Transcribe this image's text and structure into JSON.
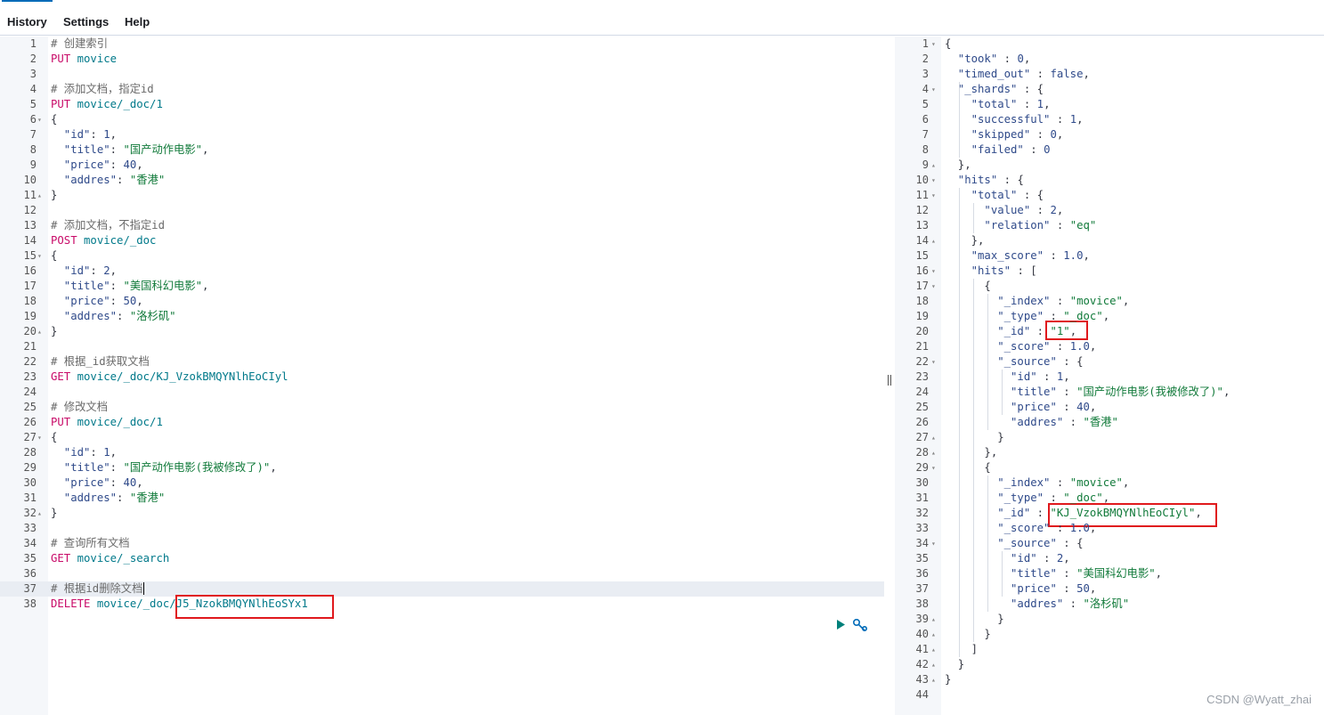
{
  "menu": {
    "history": "History",
    "settings": "Settings",
    "help": "Help"
  },
  "watermark": "CSDN @Wyatt_zhai",
  "colors": {
    "accent": "#006bb8",
    "highlight_box": "#e0191d",
    "method": "#c80a68",
    "url": "#00798a",
    "string": "#117a3a"
  },
  "icons": {
    "run": "play-icon",
    "settings": "wrench-icon"
  },
  "left": {
    "lines": [
      [
        {
          "t": "# 创建索引",
          "c": "comment"
        }
      ],
      [
        {
          "t": "PUT",
          "c": "method"
        },
        {
          "t": " movice",
          "c": "url"
        }
      ],
      [],
      [
        {
          "t": "# 添加文档，指定id",
          "c": "comment"
        }
      ],
      [
        {
          "t": "PUT",
          "c": "method"
        },
        {
          "t": " movice/_doc/1",
          "c": "url"
        }
      ],
      [
        {
          "t": "{",
          "c": "punc"
        }
      ],
      [
        {
          "t": "  \"id\"",
          "c": "key"
        },
        {
          "t": ": ",
          "c": "punc"
        },
        {
          "t": "1",
          "c": "num"
        },
        {
          "t": ",",
          "c": "punc"
        }
      ],
      [
        {
          "t": "  \"title\"",
          "c": "key"
        },
        {
          "t": ": ",
          "c": "punc"
        },
        {
          "t": "\"国产动作电影\"",
          "c": "str"
        },
        {
          "t": ",",
          "c": "punc"
        }
      ],
      [
        {
          "t": "  \"price\"",
          "c": "key"
        },
        {
          "t": ": ",
          "c": "punc"
        },
        {
          "t": "40",
          "c": "num"
        },
        {
          "t": ",",
          "c": "punc"
        }
      ],
      [
        {
          "t": "  \"addres\"",
          "c": "key"
        },
        {
          "t": ": ",
          "c": "punc"
        },
        {
          "t": "\"香港\"",
          "c": "str"
        }
      ],
      [
        {
          "t": "}",
          "c": "punc"
        }
      ],
      [],
      [
        {
          "t": "# 添加文档，不指定id",
          "c": "comment"
        }
      ],
      [
        {
          "t": "POST",
          "c": "method"
        },
        {
          "t": " movice/_doc",
          "c": "url"
        }
      ],
      [
        {
          "t": "{",
          "c": "punc"
        }
      ],
      [
        {
          "t": "  \"id\"",
          "c": "key"
        },
        {
          "t": ": ",
          "c": "punc"
        },
        {
          "t": "2",
          "c": "num"
        },
        {
          "t": ",",
          "c": "punc"
        }
      ],
      [
        {
          "t": "  \"title\"",
          "c": "key"
        },
        {
          "t": ": ",
          "c": "punc"
        },
        {
          "t": "\"美国科幻电影\"",
          "c": "str"
        },
        {
          "t": ",",
          "c": "punc"
        }
      ],
      [
        {
          "t": "  \"price\"",
          "c": "key"
        },
        {
          "t": ": ",
          "c": "punc"
        },
        {
          "t": "50",
          "c": "num"
        },
        {
          "t": ",",
          "c": "punc"
        }
      ],
      [
        {
          "t": "  \"addres\"",
          "c": "key"
        },
        {
          "t": ": ",
          "c": "punc"
        },
        {
          "t": "\"洛杉矶\"",
          "c": "str"
        }
      ],
      [
        {
          "t": "}",
          "c": "punc"
        }
      ],
      [],
      [
        {
          "t": "# 根据_id获取文档",
          "c": "comment"
        }
      ],
      [
        {
          "t": "GET",
          "c": "method"
        },
        {
          "t": " movice/_doc/KJ_VzokBMQYNlhEoCIyl",
          "c": "url"
        }
      ],
      [],
      [
        {
          "t": "# 修改文档",
          "c": "comment"
        }
      ],
      [
        {
          "t": "PUT",
          "c": "method"
        },
        {
          "t": " movice/_doc/1",
          "c": "url"
        }
      ],
      [
        {
          "t": "{",
          "c": "punc"
        }
      ],
      [
        {
          "t": "  \"id\"",
          "c": "key"
        },
        {
          "t": ": ",
          "c": "punc"
        },
        {
          "t": "1",
          "c": "num"
        },
        {
          "t": ",",
          "c": "punc"
        }
      ],
      [
        {
          "t": "  \"title\"",
          "c": "key"
        },
        {
          "t": ": ",
          "c": "punc"
        },
        {
          "t": "\"国产动作电影(我被修改了)\"",
          "c": "str"
        },
        {
          "t": ",",
          "c": "punc"
        }
      ],
      [
        {
          "t": "  \"price\"",
          "c": "key"
        },
        {
          "t": ": ",
          "c": "punc"
        },
        {
          "t": "40",
          "c": "num"
        },
        {
          "t": ",",
          "c": "punc"
        }
      ],
      [
        {
          "t": "  \"addres\"",
          "c": "key"
        },
        {
          "t": ": ",
          "c": "punc"
        },
        {
          "t": "\"香港\"",
          "c": "str"
        }
      ],
      [
        {
          "t": "}",
          "c": "punc"
        }
      ],
      [],
      [
        {
          "t": "# 查询所有文档",
          "c": "comment"
        }
      ],
      [
        {
          "t": "GET",
          "c": "method"
        },
        {
          "t": " movice/_search",
          "c": "url"
        }
      ],
      [],
      [
        {
          "t": "# 根据id删除文档",
          "c": "comment"
        }
      ],
      [
        {
          "t": "DELETE",
          "c": "method"
        },
        {
          "t": " movice/_doc/J5_NzokBMQYNlhEoSYx1",
          "c": "url"
        }
      ]
    ],
    "folds": {
      "6": "open",
      "11": "close",
      "15": "open",
      "20": "close",
      "27": "open",
      "32": "close"
    },
    "active_line": 37
  },
  "right": {
    "lines": [
      [
        {
          "t": "{",
          "c": "punc"
        }
      ],
      [
        {
          "t": "  \"took\"",
          "c": "key"
        },
        {
          "t": " : ",
          "c": "punc"
        },
        {
          "t": "0",
          "c": "num"
        },
        {
          "t": ",",
          "c": "punc"
        }
      ],
      [
        {
          "t": "  \"timed_out\"",
          "c": "key"
        },
        {
          "t": " : ",
          "c": "punc"
        },
        {
          "t": "false",
          "c": "bool"
        },
        {
          "t": ",",
          "c": "punc"
        }
      ],
      [
        {
          "t": "  \"_shards\"",
          "c": "key"
        },
        {
          "t": " : {",
          "c": "punc"
        }
      ],
      [
        {
          "t": "    \"total\"",
          "c": "key"
        },
        {
          "t": " : ",
          "c": "punc"
        },
        {
          "t": "1",
          "c": "num"
        },
        {
          "t": ",",
          "c": "punc"
        }
      ],
      [
        {
          "t": "    \"successful\"",
          "c": "key"
        },
        {
          "t": " : ",
          "c": "punc"
        },
        {
          "t": "1",
          "c": "num"
        },
        {
          "t": ",",
          "c": "punc"
        }
      ],
      [
        {
          "t": "    \"skipped\"",
          "c": "key"
        },
        {
          "t": " : ",
          "c": "punc"
        },
        {
          "t": "0",
          "c": "num"
        },
        {
          "t": ",",
          "c": "punc"
        }
      ],
      [
        {
          "t": "    \"failed\"",
          "c": "key"
        },
        {
          "t": " : ",
          "c": "punc"
        },
        {
          "t": "0",
          "c": "num"
        }
      ],
      [
        {
          "t": "  },",
          "c": "punc"
        }
      ],
      [
        {
          "t": "  \"hits\"",
          "c": "key"
        },
        {
          "t": " : {",
          "c": "punc"
        }
      ],
      [
        {
          "t": "    \"total\"",
          "c": "key"
        },
        {
          "t": " : {",
          "c": "punc"
        }
      ],
      [
        {
          "t": "      \"value\"",
          "c": "key"
        },
        {
          "t": " : ",
          "c": "punc"
        },
        {
          "t": "2",
          "c": "num"
        },
        {
          "t": ",",
          "c": "punc"
        }
      ],
      [
        {
          "t": "      \"relation\"",
          "c": "key"
        },
        {
          "t": " : ",
          "c": "punc"
        },
        {
          "t": "\"eq\"",
          "c": "str"
        }
      ],
      [
        {
          "t": "    },",
          "c": "punc"
        }
      ],
      [
        {
          "t": "    \"max_score\"",
          "c": "key"
        },
        {
          "t": " : ",
          "c": "punc"
        },
        {
          "t": "1.0",
          "c": "num"
        },
        {
          "t": ",",
          "c": "punc"
        }
      ],
      [
        {
          "t": "    \"hits\"",
          "c": "key"
        },
        {
          "t": " : [",
          "c": "punc"
        }
      ],
      [
        {
          "t": "      {",
          "c": "punc"
        }
      ],
      [
        {
          "t": "        \"_index\"",
          "c": "key"
        },
        {
          "t": " : ",
          "c": "punc"
        },
        {
          "t": "\"movice\"",
          "c": "str"
        },
        {
          "t": ",",
          "c": "punc"
        }
      ],
      [
        {
          "t": "        \"_type\"",
          "c": "key"
        },
        {
          "t": " : ",
          "c": "punc"
        },
        {
          "t": "\"_doc\"",
          "c": "str"
        },
        {
          "t": ",",
          "c": "punc"
        }
      ],
      [
        {
          "t": "        \"_id\"",
          "c": "key"
        },
        {
          "t": " : ",
          "c": "punc"
        },
        {
          "t": "\"1\"",
          "c": "str"
        },
        {
          "t": ",",
          "c": "punc"
        }
      ],
      [
        {
          "t": "        \"_score\"",
          "c": "key"
        },
        {
          "t": " : ",
          "c": "punc"
        },
        {
          "t": "1.0",
          "c": "num"
        },
        {
          "t": ",",
          "c": "punc"
        }
      ],
      [
        {
          "t": "        \"_source\"",
          "c": "key"
        },
        {
          "t": " : {",
          "c": "punc"
        }
      ],
      [
        {
          "t": "          \"id\"",
          "c": "key"
        },
        {
          "t": " : ",
          "c": "punc"
        },
        {
          "t": "1",
          "c": "num"
        },
        {
          "t": ",",
          "c": "punc"
        }
      ],
      [
        {
          "t": "          \"title\"",
          "c": "key"
        },
        {
          "t": " : ",
          "c": "punc"
        },
        {
          "t": "\"国产动作电影(我被修改了)\"",
          "c": "str"
        },
        {
          "t": ",",
          "c": "punc"
        }
      ],
      [
        {
          "t": "          \"price\"",
          "c": "key"
        },
        {
          "t": " : ",
          "c": "punc"
        },
        {
          "t": "40",
          "c": "num"
        },
        {
          "t": ",",
          "c": "punc"
        }
      ],
      [
        {
          "t": "          \"addres\"",
          "c": "key"
        },
        {
          "t": " : ",
          "c": "punc"
        },
        {
          "t": "\"香港\"",
          "c": "str"
        }
      ],
      [
        {
          "t": "        }",
          "c": "punc"
        }
      ],
      [
        {
          "t": "      },",
          "c": "punc"
        }
      ],
      [
        {
          "t": "      {",
          "c": "punc"
        }
      ],
      [
        {
          "t": "        \"_index\"",
          "c": "key"
        },
        {
          "t": " : ",
          "c": "punc"
        },
        {
          "t": "\"movice\"",
          "c": "str"
        },
        {
          "t": ",",
          "c": "punc"
        }
      ],
      [
        {
          "t": "        \"_type\"",
          "c": "key"
        },
        {
          "t": " : ",
          "c": "punc"
        },
        {
          "t": "\"_doc\"",
          "c": "str"
        },
        {
          "t": ",",
          "c": "punc"
        }
      ],
      [
        {
          "t": "        \"_id\"",
          "c": "key"
        },
        {
          "t": " : ",
          "c": "punc"
        },
        {
          "t": "\"KJ_VzokBMQYNlhEoCIyl\"",
          "c": "str"
        },
        {
          "t": ",",
          "c": "punc"
        }
      ],
      [
        {
          "t": "        \"_score\"",
          "c": "key"
        },
        {
          "t": " : ",
          "c": "punc"
        },
        {
          "t": "1.0",
          "c": "num"
        },
        {
          "t": ",",
          "c": "punc"
        }
      ],
      [
        {
          "t": "        \"_source\"",
          "c": "key"
        },
        {
          "t": " : {",
          "c": "punc"
        }
      ],
      [
        {
          "t": "          \"id\"",
          "c": "key"
        },
        {
          "t": " : ",
          "c": "punc"
        },
        {
          "t": "2",
          "c": "num"
        },
        {
          "t": ",",
          "c": "punc"
        }
      ],
      [
        {
          "t": "          \"title\"",
          "c": "key"
        },
        {
          "t": " : ",
          "c": "punc"
        },
        {
          "t": "\"美国科幻电影\"",
          "c": "str"
        },
        {
          "t": ",",
          "c": "punc"
        }
      ],
      [
        {
          "t": "          \"price\"",
          "c": "key"
        },
        {
          "t": " : ",
          "c": "punc"
        },
        {
          "t": "50",
          "c": "num"
        },
        {
          "t": ",",
          "c": "punc"
        }
      ],
      [
        {
          "t": "          \"addres\"",
          "c": "key"
        },
        {
          "t": " : ",
          "c": "punc"
        },
        {
          "t": "\"洛杉矶\"",
          "c": "str"
        }
      ],
      [
        {
          "t": "        }",
          "c": "punc"
        }
      ],
      [
        {
          "t": "      }",
          "c": "punc"
        }
      ],
      [
        {
          "t": "    ]",
          "c": "punc"
        }
      ],
      [
        {
          "t": "  }",
          "c": "punc"
        }
      ],
      [
        {
          "t": "}",
          "c": "punc"
        }
      ],
      []
    ],
    "folds": {
      "1": "open",
      "4": "open",
      "9": "close",
      "10": "open",
      "11": "open",
      "14": "close",
      "16": "open",
      "17": "open",
      "22": "open",
      "27": "close",
      "28": "close",
      "29": "open",
      "34": "open",
      "39": "close",
      "40": "close",
      "41": "close",
      "42": "close",
      "43": "close"
    }
  }
}
